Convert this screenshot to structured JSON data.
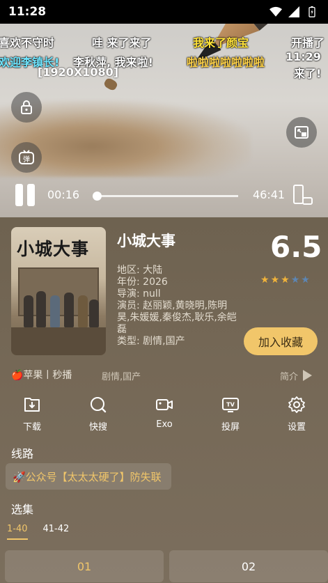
{
  "status_bar": {
    "time": "11:28"
  },
  "player": {
    "danmaku": [
      "喜欢不守时",
      "哇 来了来了",
      "我来了颜宝",
      "开播了",
      "欢迎李镇长!",
      "李秋萍, 我来啦!",
      "啦啦啦啦啦啦啦",
      "11:29",
      "来了!"
    ],
    "resolution": "[1920X1080]",
    "current_time": "00:16",
    "total_time": "46:41",
    "progress": 0.006
  },
  "show": {
    "poster_title": "小城大事",
    "title": "小城大事",
    "score": "6.5",
    "rating_stars": 3.5,
    "region": "地区: 大陆",
    "year": "年份: 2026",
    "director": "导演: null",
    "cast": "演员: 赵丽颖,黄晓明,陈明昊,朱媛媛,秦俊杰,耿乐,余皑磊",
    "type": "类型: 剧情,国产",
    "favorite_label": "加入收藏"
  },
  "source_row": {
    "source": "🍎苹果丨秒播",
    "genre": "剧情,国产",
    "intro": "简介"
  },
  "tools": [
    {
      "label": "下载",
      "icon": "download-icon"
    },
    {
      "label": "快搜",
      "icon": "search-icon"
    },
    {
      "label": "Exo",
      "icon": "camera-icon"
    },
    {
      "label": "投屏",
      "icon": "tv-cast-icon"
    },
    {
      "label": "设置",
      "icon": "gear-icon"
    }
  ],
  "lines": {
    "label": "线路",
    "item": "🚀公众号【太太太硬了】防失联"
  },
  "episodes": {
    "label": "选集",
    "tabs": [
      "1-40",
      "41-42"
    ],
    "items": [
      "01",
      "02"
    ]
  },
  "colors": {
    "accent": "#f1c66a",
    "background": "#6f6251"
  }
}
